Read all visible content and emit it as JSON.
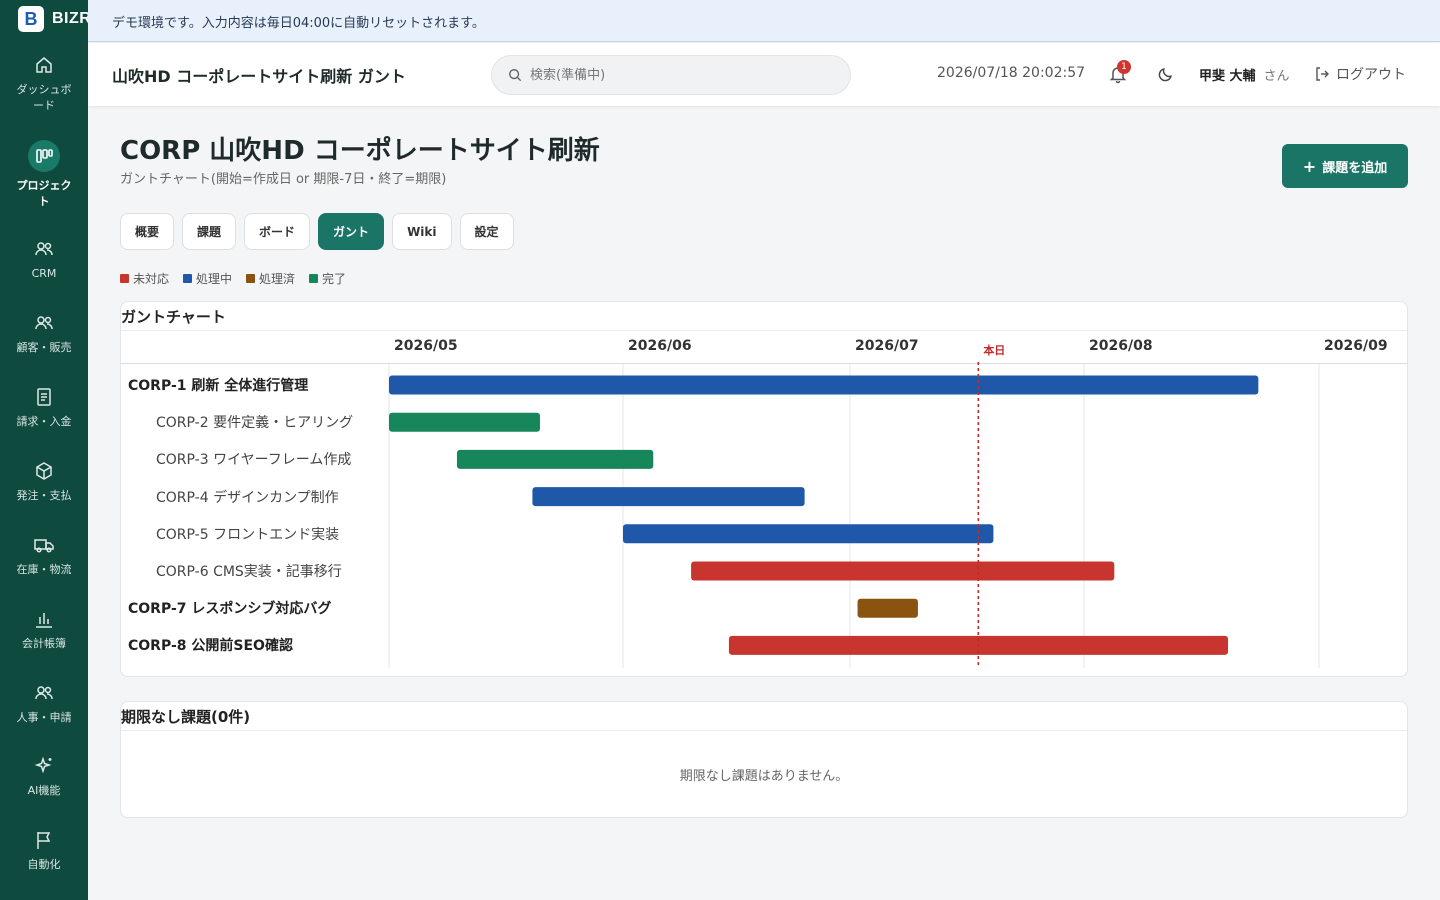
{
  "sidebar": {
    "logo_text": "BIZR",
    "items": [
      {
        "label": "ダッシュボード",
        "icon": "home-icon"
      },
      {
        "label": "プロジェクト",
        "icon": "project-icon",
        "active": true
      },
      {
        "label": "CRM",
        "icon": "users-icon"
      },
      {
        "label": "顧客・販売",
        "icon": "users-icon"
      },
      {
        "label": "請求・入金",
        "icon": "invoice-icon"
      },
      {
        "label": "発注・支払",
        "icon": "box-icon"
      },
      {
        "label": "在庫・物流",
        "icon": "truck-icon"
      },
      {
        "label": "会計帳簿",
        "icon": "bar-chart-icon"
      },
      {
        "label": "人事・申請",
        "icon": "users-icon"
      },
      {
        "label": "AI機能",
        "icon": "sparkle-icon"
      },
      {
        "label": "自動化",
        "icon": "flag-icon"
      }
    ]
  },
  "banner": {
    "text": "デモ環境です。入力内容は毎日04:00に自動リセットされます。"
  },
  "header": {
    "title": "山吹HD コーポレートサイト刷新 ガント",
    "search_placeholder": "検索(準備中)",
    "datetime": "2026/07/18 20:02:57",
    "notification_count": "1",
    "user_name": "甲斐 大輔",
    "user_suffix": "さん",
    "logout_label": "ログアウト"
  },
  "page": {
    "title": "CORP 山吹HD コーポレートサイト刷新",
    "subtitle": "ガントチャート(開始=作成日 or 期限-7日・終了=期限)",
    "add_button": "課題を追加"
  },
  "tabs": [
    {
      "label": "概要"
    },
    {
      "label": "課題"
    },
    {
      "label": "ボード"
    },
    {
      "label": "ガント",
      "active": true
    },
    {
      "label": "Wiki"
    },
    {
      "label": "設定"
    }
  ],
  "legend": [
    {
      "label": "未対応",
      "color": "#c8352e"
    },
    {
      "label": "処理中",
      "color": "#1f58a8"
    },
    {
      "label": "処理済",
      "color": "#8a5410"
    },
    {
      "label": "完了",
      "color": "#17865a"
    }
  ],
  "gantt": {
    "title": "ガントチャート",
    "months": [
      "2026/05",
      "2026/06",
      "2026/07",
      "2026/08",
      "2026/09"
    ],
    "today_label": "本日",
    "today": "2026-07-18",
    "tasks": [
      {
        "label": "CORP-1 刷新 全体進行管理",
        "parent": true,
        "start": "2026-05-01",
        "end": "2026-08-24",
        "status": "処理中"
      },
      {
        "label": "CORP-2 要件定義・ヒアリング",
        "parent": false,
        "start": "2026-05-01",
        "end": "2026-05-21",
        "status": "完了"
      },
      {
        "label": "CORP-3 ワイヤーフレーム作成",
        "parent": false,
        "start": "2026-05-10",
        "end": "2026-06-05",
        "status": "完了"
      },
      {
        "label": "CORP-4 デザインカンプ制作",
        "parent": false,
        "start": "2026-05-20",
        "end": "2026-06-25",
        "status": "処理中"
      },
      {
        "label": "CORP-5 フロントエンド実装",
        "parent": false,
        "start": "2026-06-01",
        "end": "2026-07-20",
        "status": "処理中"
      },
      {
        "label": "CORP-6 CMS実装・記事移行",
        "parent": false,
        "start": "2026-06-10",
        "end": "2026-08-05",
        "status": "未対応"
      },
      {
        "label": "CORP-7 レスポンシブ対応バグ",
        "parent": true,
        "start": "2026-07-02",
        "end": "2026-07-10",
        "status": "処理済"
      },
      {
        "label": "CORP-8 公開前SEO確認",
        "parent": true,
        "start": "2026-06-15",
        "end": "2026-08-20",
        "status": "未対応"
      }
    ]
  },
  "no_deadline": {
    "title": "期限なし課題(0件)",
    "empty_message": "期限なし課題はありません。"
  }
}
